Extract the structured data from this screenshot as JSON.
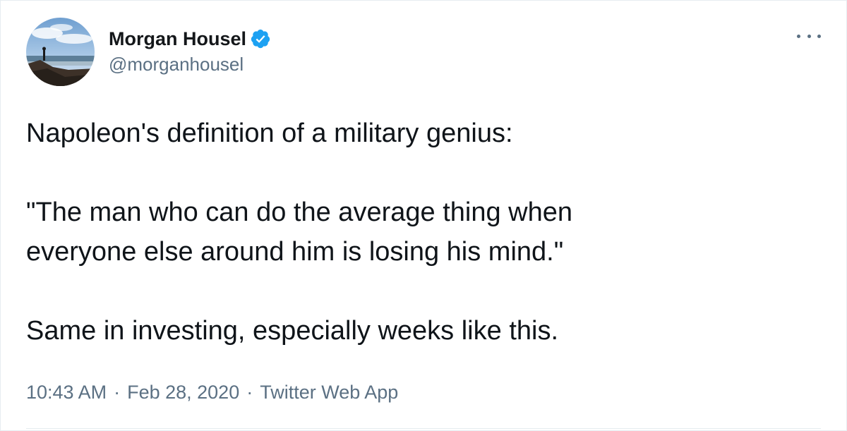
{
  "author": {
    "display_name": "Morgan Housel",
    "handle": "@morganhousel",
    "verified": true,
    "avatar_icon": "profile-photo-coast-icon"
  },
  "tweet": {
    "line1": "Napoleon's definition of a military genius:",
    "quote_line1": "\"The man who can do the average thing when",
    "quote_line2": "everyone else around him is losing his mind.\"",
    "line3": "Same in investing, especially weeks like this."
  },
  "meta": {
    "time": "10:43 AM",
    "separator": "·",
    "date": "Feb 28, 2020",
    "source": "Twitter Web App"
  },
  "colors": {
    "text": "#0f1419",
    "secondary": "#5b7083",
    "verified_blue": "#1da1f2",
    "border": "#e6ecf0"
  },
  "icons": {
    "more": "more-dots-icon",
    "verified": "verified-badge-icon"
  }
}
